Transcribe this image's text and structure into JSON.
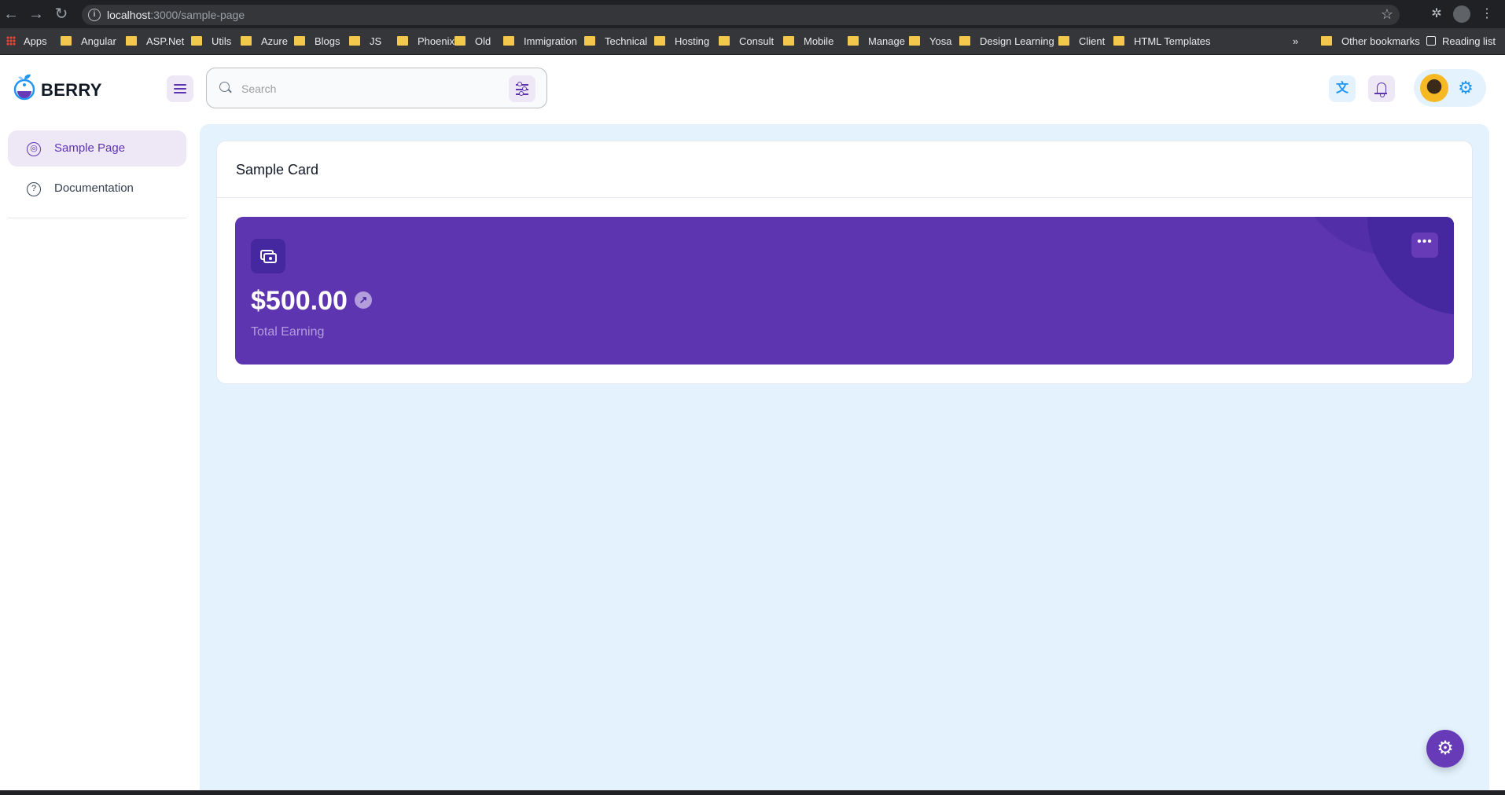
{
  "browser": {
    "url_host": "localhost",
    "url_path": ":3000/sample-page",
    "bookmarks": [
      "Apps",
      "Angular",
      "ASP.Net",
      "Utils",
      "Azure",
      "Blogs",
      "JS",
      "Phoenix",
      "Old",
      "Immigration",
      "Technical",
      "Hosting",
      "Consult",
      "Mobile",
      "Manage",
      "Yosa",
      "Design Learning",
      "Client",
      "HTML Templates"
    ],
    "overflow": "»",
    "other_bookmarks": "Other bookmarks",
    "reading_list": "Reading list"
  },
  "header": {
    "brand": "BERRY",
    "search_placeholder": "Search"
  },
  "sidebar": {
    "items": [
      {
        "label": "Sample Page",
        "icon": "brand-chrome-icon",
        "active": true
      },
      {
        "label": "Documentation",
        "icon": "help-icon",
        "active": false
      }
    ]
  },
  "main": {
    "card_title": "Sample Card",
    "earning": {
      "amount": "$500.00",
      "label": "Total Earning"
    }
  },
  "colors": {
    "primary": "#5e35b1",
    "secondary_light": "#ede7f6",
    "main_bg": "#e3f2fd",
    "accent_blue": "#2196f3"
  }
}
